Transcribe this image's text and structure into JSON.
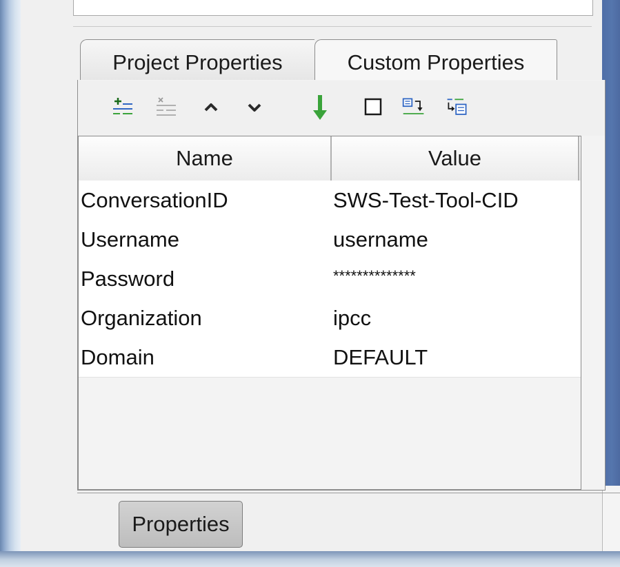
{
  "tabs": {
    "project_label": "Project Properties",
    "custom_label": "Custom Properties"
  },
  "toolbar": {
    "icons": [
      "add-property-icon",
      "remove-property-icon",
      "move-up-icon",
      "move-down-icon",
      "download-arrow-icon",
      "checkbox-icon",
      "import-properties-icon",
      "export-properties-icon"
    ],
    "colors": {
      "accent_green": "#3aa33a",
      "accent_blue": "#2f66c4"
    }
  },
  "table": {
    "columns": [
      "Name",
      "Value"
    ],
    "rows": [
      {
        "name": "ConversationID",
        "value": "SWS-Test-Tool-CID"
      },
      {
        "name": "Username",
        "value": "username"
      },
      {
        "name": "Password",
        "value": "**************"
      },
      {
        "name": "Organization",
        "value": "ipcc"
      },
      {
        "name": "Domain",
        "value": "DEFAULT"
      }
    ]
  },
  "footer": {
    "properties_button": "Properties"
  }
}
